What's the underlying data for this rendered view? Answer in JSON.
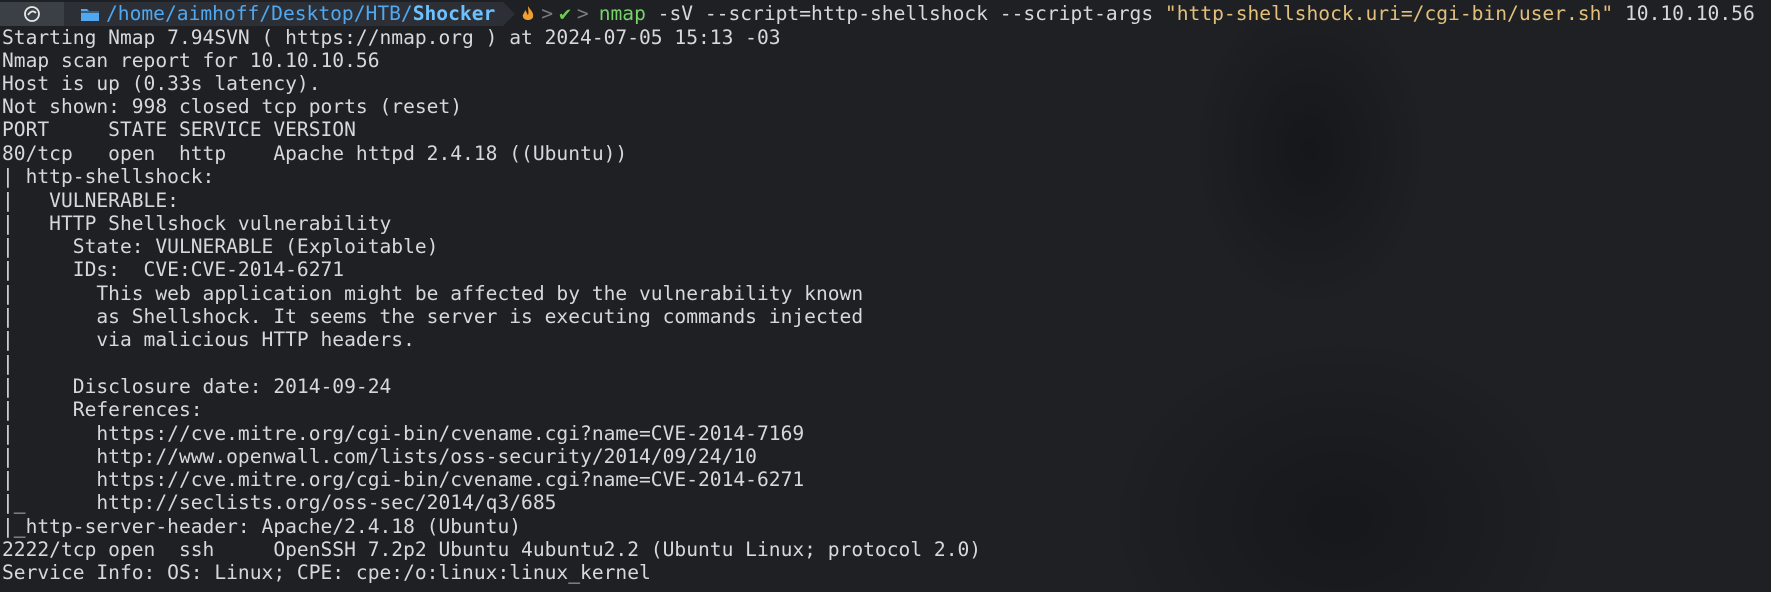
{
  "prompt": {
    "os_icon": "os-logo-icon",
    "folder_icon": "folder-icon",
    "path_parent": "/home/aimhoff/Desktop/HTB/",
    "path_current": "Shocker",
    "chevron": ">",
    "fire_icon": "fire-icon",
    "check_mark": "✔"
  },
  "command": {
    "name": "nmap",
    "args": " -sV --script=http-shellshock --script-args ",
    "quoted": "\"http-shellshock.uri=/cgi-bin/user.sh\"",
    "target": " 10.10.10.56"
  },
  "output": [
    "Starting Nmap 7.94SVN ( https://nmap.org ) at 2024-07-05 15:13 -03",
    "Nmap scan report for 10.10.10.56",
    "Host is up (0.33s latency).",
    "Not shown: 998 closed tcp ports (reset)",
    "PORT     STATE SERVICE VERSION",
    "80/tcp   open  http    Apache httpd 2.4.18 ((Ubuntu))",
    "| http-shellshock:",
    "|   VULNERABLE:",
    "|   HTTP Shellshock vulnerability",
    "|     State: VULNERABLE (Exploitable)",
    "|     IDs:  CVE:CVE-2014-6271",
    "|       This web application might be affected by the vulnerability known",
    "|       as Shellshock. It seems the server is executing commands injected",
    "|       via malicious HTTP headers.",
    "|",
    "|     Disclosure date: 2014-09-24",
    "|     References:",
    "|       https://cve.mitre.org/cgi-bin/cvename.cgi?name=CVE-2014-7169",
    "|       http://www.openwall.com/lists/oss-security/2014/09/24/10",
    "|       https://cve.mitre.org/cgi-bin/cvename.cgi?name=CVE-2014-6271",
    "|_      http://seclists.org/oss-sec/2014/q3/685",
    "|_http-server-header: Apache/2.4.18 (Ubuntu)",
    "2222/tcp open  ssh     OpenSSH 7.2p2 Ubuntu 4ubuntu2.2 (Ubuntu Linux; protocol 2.0)",
    "Service Info: OS: Linux; CPE: cpe:/o:linux:linux_kernel"
  ],
  "colors": {
    "background": "#1e2024",
    "text": "#d6d8dc",
    "path": "#4fa8f0",
    "command": "#76d46a",
    "string": "#e2c07a",
    "fire": "#f0a030",
    "check": "#6ad04a"
  }
}
